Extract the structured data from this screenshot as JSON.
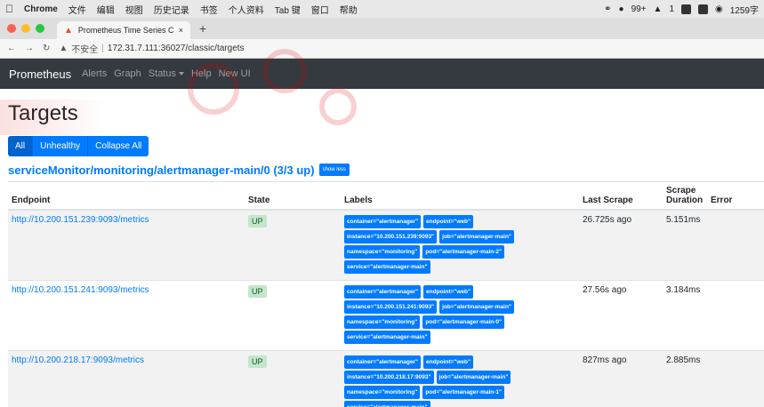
{
  "mac_menu": {
    "apple": "",
    "app": "Chrome",
    "items": [
      "文件",
      "编辑",
      "视图",
      "历史记录",
      "书签",
      "个人资料",
      "Tab 键",
      "窗口",
      "帮助"
    ],
    "status": [
      "99+",
      "1",
      "1259字"
    ]
  },
  "browser": {
    "tab_title": "Prometheus Time Series Collec",
    "new_tab": "+",
    "security": "不安全",
    "host": "172.31.7.111",
    "path": ":36027/classic/targets"
  },
  "navbar": {
    "brand": "Prometheus",
    "links": [
      "Alerts",
      "Graph",
      "Status",
      "Help",
      "New UI"
    ]
  },
  "page": {
    "title": "Targets",
    "filters": [
      "All",
      "Unhealthy",
      "Collapse All"
    ],
    "job_title": "serviceMonitor/monitoring/alertmanager-main/0 (3/3 up)",
    "show_less": "show less"
  },
  "table": {
    "headers": [
      "Endpoint",
      "State",
      "Labels",
      "Last Scrape",
      "Scrape Duration",
      "Error"
    ],
    "rows": [
      {
        "endpoint": "http://10.200.151.239:9093/metrics",
        "state": "UP",
        "labels": [
          "container=\"alertmanager\"",
          "endpoint=\"web\"",
          "instance=\"10.200.151.239:9093\"",
          "job=\"alertmanager-main\"",
          "namespace=\"monitoring\"",
          "pod=\"alertmanager-main-2\"",
          "service=\"alertmanager-main\""
        ],
        "last_scrape": "26.725s ago",
        "duration": "5.151ms",
        "error": ""
      },
      {
        "endpoint": "http://10.200.151.241:9093/metrics",
        "state": "UP",
        "labels": [
          "container=\"alertmanager\"",
          "endpoint=\"web\"",
          "instance=\"10.200.151.241:9093\"",
          "job=\"alertmanager-main\"",
          "namespace=\"monitoring\"",
          "pod=\"alertmanager-main-0\"",
          "service=\"alertmanager-main\""
        ],
        "last_scrape": "27.56s ago",
        "duration": "3.184ms",
        "error": ""
      },
      {
        "endpoint": "http://10.200.218.17:9093/metrics",
        "state": "UP",
        "labels": [
          "container=\"alertmanager\"",
          "endpoint=\"web\"",
          "instance=\"10.200.218.17:9093\"",
          "job=\"alertmanager-main\"",
          "namespace=\"monitoring\"",
          "pod=\"alertmanager-main-1\"",
          "service=\"alertmanager-main\""
        ],
        "last_scrape": "827ms ago",
        "duration": "2.885ms",
        "error": ""
      }
    ]
  }
}
